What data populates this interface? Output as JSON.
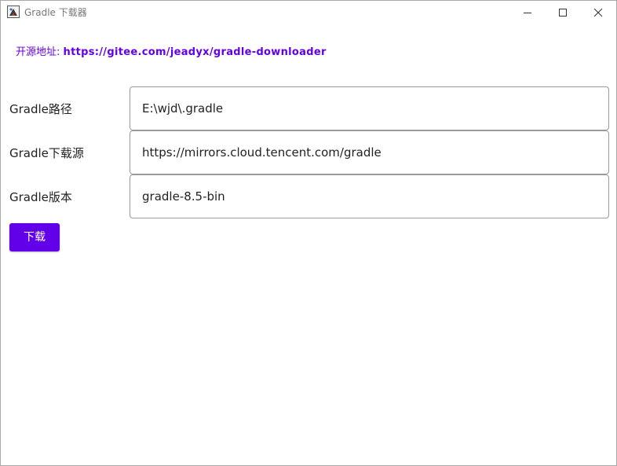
{
  "window": {
    "title": "Gradle 下载器",
    "icon": "java-cup-icon"
  },
  "source": {
    "label": "开源地址:",
    "url": "https://gitee.com/jeadyx/gradle-downloader"
  },
  "form": {
    "path": {
      "label": "Gradle路径",
      "value": "E:\\wjd\\.gradle"
    },
    "mirror": {
      "label": "Gradle下载源",
      "value": "https://mirrors.cloud.tencent.com/gradle"
    },
    "version": {
      "label": "Gradle版本",
      "value": "gradle-8.5-bin"
    }
  },
  "actions": {
    "download_label": "下载"
  },
  "colors": {
    "accent": "#6200ea",
    "input_border": "#9a9a9a",
    "text": "#222222"
  }
}
